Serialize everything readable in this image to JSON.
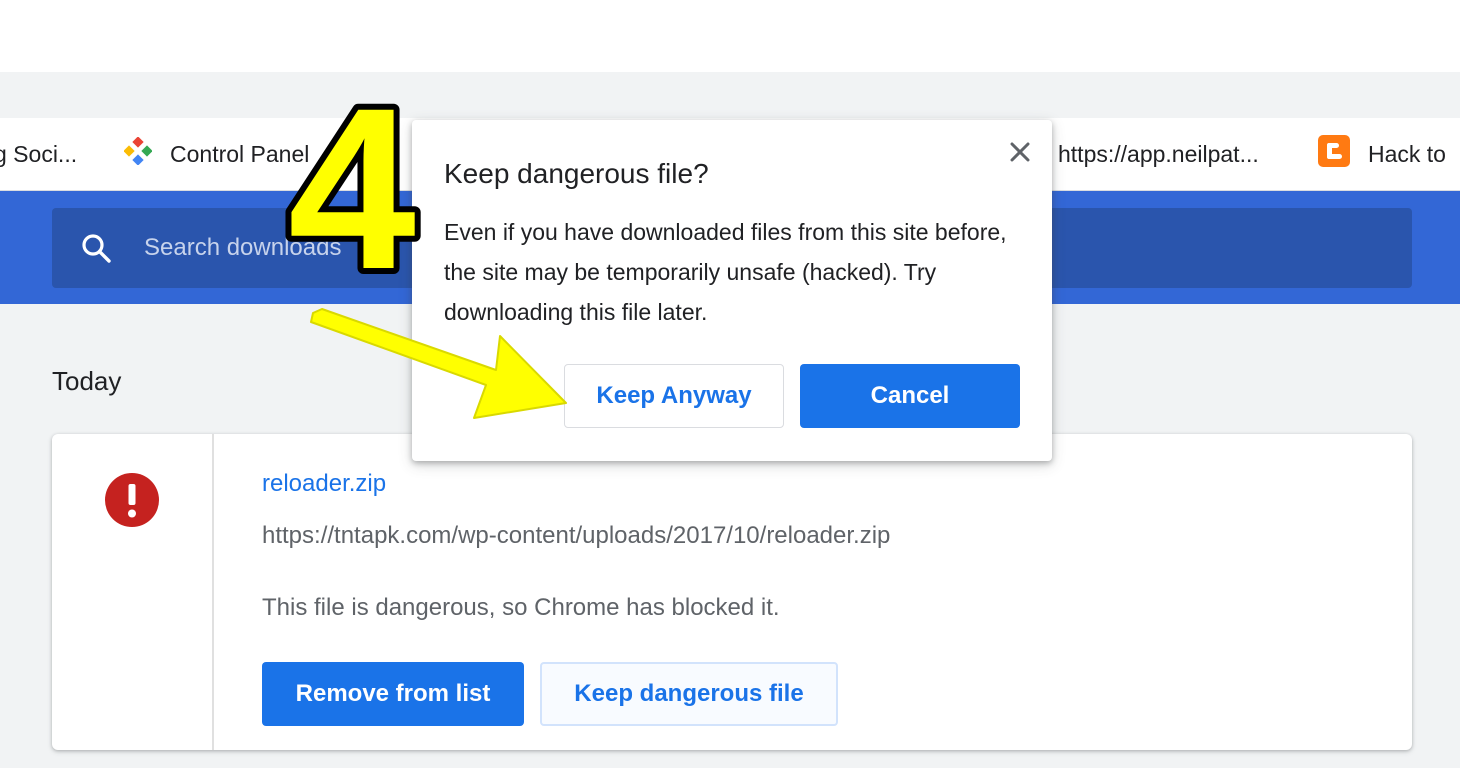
{
  "bookmarks": [
    {
      "label": "g Soci...",
      "icon": "none"
    },
    {
      "label": "Control Panel",
      "icon": "control-panel-icon"
    },
    {
      "label": "https://app.neilpat...",
      "icon": "none"
    },
    {
      "label": "Hack to",
      "icon": "blogger-icon"
    }
  ],
  "search": {
    "placeholder": "Search downloads"
  },
  "section": {
    "title": "Today"
  },
  "download": {
    "file_name": "reloader.zip",
    "url": "https://tntapk.com/wp-content/uploads/2017/10/reloader.zip",
    "status": "This file is dangerous, so Chrome has blocked it.",
    "remove_label": "Remove from list",
    "keep_label": "Keep dangerous file"
  },
  "dialog": {
    "title": "Keep dangerous file?",
    "body": "Even if you have downloaded files from this site before, the site may be temporarily unsafe (hacked). Try downloading this file later.",
    "keep_anyway_label": "Keep Anyway",
    "cancel_label": "Cancel"
  },
  "annotation": {
    "step_number": "4",
    "color": "#ffff00"
  },
  "colors": {
    "accent": "#1a73e8",
    "toolbar_blue": "#3367d6",
    "danger": "#c5221f"
  }
}
